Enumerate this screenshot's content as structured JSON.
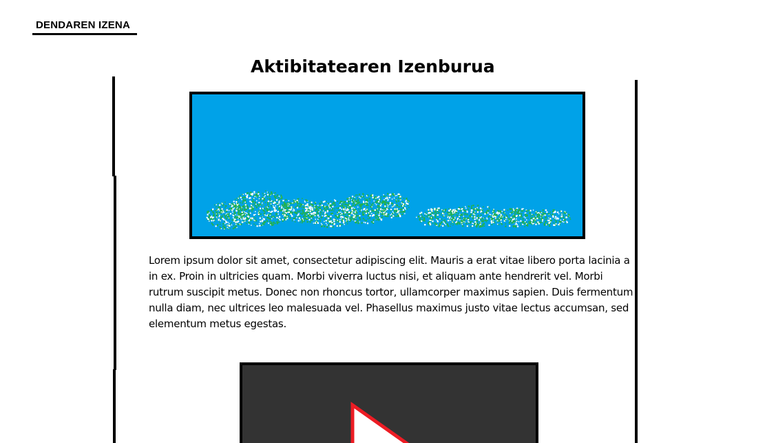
{
  "header": {
    "store_name": "DENDAREN IZENA"
  },
  "main": {
    "activity_title": "Aktibitatearen Izenburua",
    "description": "Lorem ipsum dolor sit amet, consectetur adipiscing elit. Mauris a erat vitae libero porta lacinia a in ex. Proin in ultricies quam. Morbi viverra luctus nisi, et aliquam ante hendrerit vel. Morbi rutrum suscipit metus. Donec non rhoncus tortor, ullamcorper maximus sapien. Duis fermentum nulla diam, nec ultrices leo malesuada vel. Phasellus maximus justo vitae lectus accumsan, sed elementum metus egestas."
  },
  "colors": {
    "banner_sky": "#00a2e8",
    "banner_grass": "#22b14c",
    "video_background": "#333333",
    "play_outline": "#ed1c24",
    "frame_lines": "#000000"
  },
  "icons": {
    "video_play": "play-icon"
  }
}
